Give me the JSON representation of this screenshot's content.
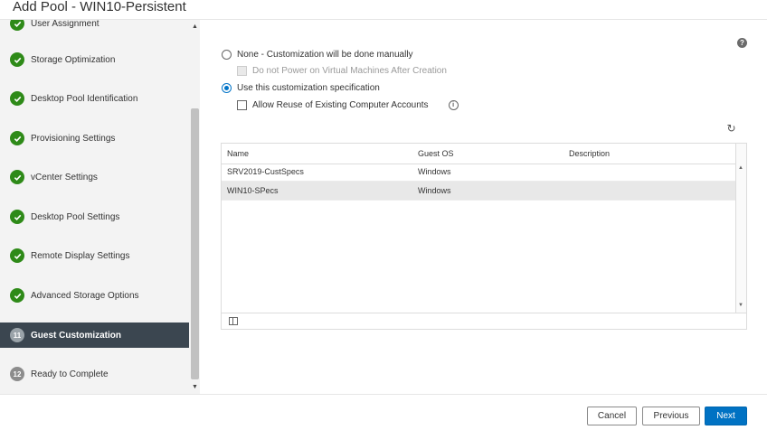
{
  "window": {
    "title": "Add Pool - WIN10-Persistent"
  },
  "sidebar": {
    "items": [
      {
        "label": "User Assignment",
        "state": "done"
      },
      {
        "label": "Storage Optimization",
        "state": "done"
      },
      {
        "label": "Desktop Pool Identification",
        "state": "done"
      },
      {
        "label": "Provisioning Settings",
        "state": "done"
      },
      {
        "label": "vCenter Settings",
        "state": "done"
      },
      {
        "label": "Desktop Pool Settings",
        "state": "done"
      },
      {
        "label": "Remote Display Settings",
        "state": "done"
      },
      {
        "label": "Advanced Storage Options",
        "state": "done"
      },
      {
        "label": "Guest Customization",
        "number": "11",
        "state": "active"
      },
      {
        "label": "Ready to Complete",
        "number": "12",
        "state": "pending"
      }
    ]
  },
  "options": {
    "none_label": "None - Customization will be done manually",
    "no_power_label": "Do not Power on Virtual Machines After Creation",
    "use_spec_label": "Use this customization specification",
    "allow_reuse_label": "Allow Reuse of Existing Computer Accounts"
  },
  "icons": {
    "help": "?",
    "info": "i",
    "refresh": "↻",
    "check": "✓",
    "scroll_up": "▲",
    "scroll_down": "▼"
  },
  "table": {
    "columns": [
      "Name",
      "Guest OS",
      "Description"
    ],
    "rows": [
      {
        "name": "SRV2019-CustSpecs",
        "os": "Windows",
        "description": ""
      },
      {
        "name": "WIN10-SPecs",
        "os": "Windows",
        "description": ""
      }
    ]
  },
  "buttons": {
    "cancel": "Cancel",
    "previous": "Previous",
    "next": "Next"
  },
  "colors": {
    "done": "#2e8a18",
    "active_bg": "#3b4650",
    "primary": "#0072c3"
  }
}
